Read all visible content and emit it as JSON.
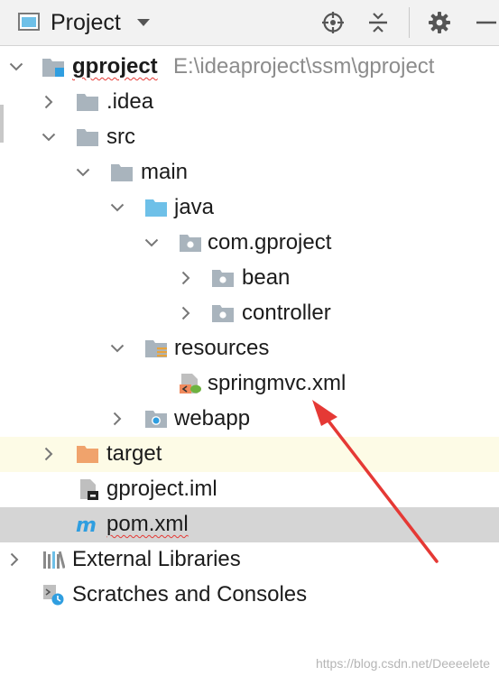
{
  "panel": {
    "title": "Project",
    "view_icon": "project-view-icon",
    "dropdown_icon": "chevron-down-icon",
    "tools": [
      "locate-icon",
      "collapse-all-icon",
      "gear-icon",
      "minimize-icon"
    ]
  },
  "tree": {
    "root": {
      "name": "gproject",
      "path": "E:\\ideaproject\\ssm\\gproject"
    },
    "idea": ".idea",
    "src": "src",
    "main": "main",
    "java": "java",
    "package": "com.gproject",
    "bean": "bean",
    "controller": "controller",
    "resources": "resources",
    "springmvc": "springmvc.xml",
    "webapp": "webapp",
    "target": "target",
    "iml": "gproject.iml",
    "pom": "pom.xml",
    "libs": "External Libraries",
    "scratches": "Scratches and Consoles"
  },
  "colors": {
    "folder": "#a9b4bd",
    "source_folder": "#6ec0e8",
    "excluded_folder": "#f0a36c",
    "arrow": "#e53935",
    "selected_row": "#d5d5d5",
    "excluded_row": "#fdfbe6"
  },
  "watermark": "https://blog.csdn.net/Deeeelete"
}
